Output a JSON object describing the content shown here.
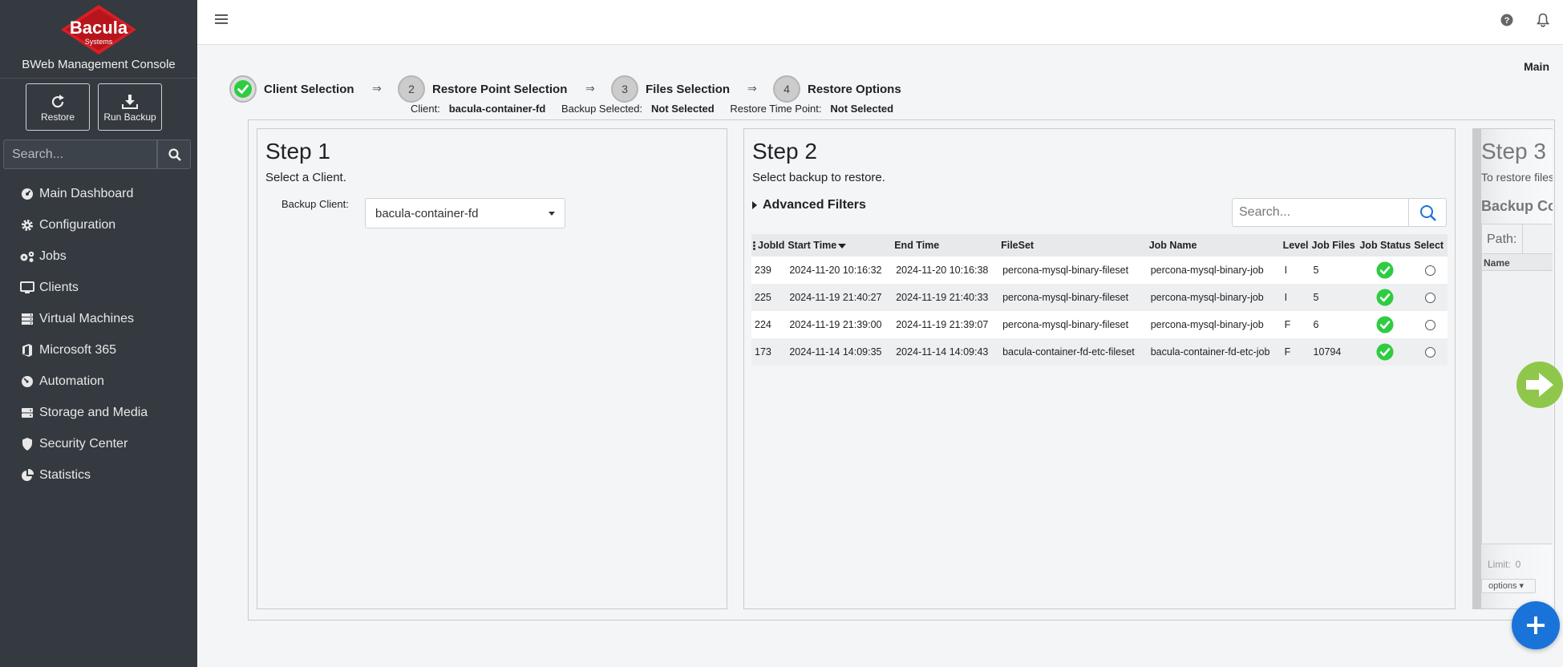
{
  "sidebar": {
    "logo_text": "Bacula",
    "logo_sub": "Systems",
    "console_title": "BWeb Management Console",
    "actions": [
      {
        "label": "Restore",
        "icon": "refresh-icon"
      },
      {
        "label": "Run Backup",
        "icon": "download-icon"
      }
    ],
    "search_placeholder": "Search...",
    "nav": [
      {
        "label": "Main Dashboard",
        "icon": "dashboard-icon"
      },
      {
        "label": "Configuration",
        "icon": "gear-icon"
      },
      {
        "label": "Jobs",
        "icon": "gears-icon"
      },
      {
        "label": "Clients",
        "icon": "monitor-icon"
      },
      {
        "label": "Virtual Machines",
        "icon": "server-icon"
      },
      {
        "label": "Microsoft 365",
        "icon": "office-icon"
      },
      {
        "label": "Automation",
        "icon": "gauge-icon"
      },
      {
        "label": "Storage and Media",
        "icon": "hdd-icon"
      },
      {
        "label": "Security Center",
        "icon": "shield-icon"
      },
      {
        "label": "Statistics",
        "icon": "pie-chart-icon"
      }
    ]
  },
  "topbar": {
    "main_link": "Main"
  },
  "wizard": {
    "steps": [
      {
        "number": "1",
        "label": "Client Selection",
        "done": true
      },
      {
        "number": "2",
        "label": "Restore Point Selection",
        "done": false
      },
      {
        "number": "3",
        "label": "Files Selection",
        "done": false
      },
      {
        "number": "4",
        "label": "Restore Options",
        "done": false
      }
    ],
    "arrow": "⇒",
    "summary": {
      "client_label": "Client:",
      "client_value": "bacula-container-fd",
      "backup_label": "Backup Selected:",
      "backup_value": "Not Selected",
      "time_label": "Restore Time Point:",
      "time_value": "Not Selected"
    }
  },
  "step1": {
    "title": "Step 1",
    "description": "Select a Client.",
    "client_label": "Backup Client:",
    "client_value": "bacula-container-fd"
  },
  "step2": {
    "title": "Step 2",
    "description": "Select backup to restore.",
    "advanced_filters": "Advanced Filters",
    "search_placeholder": "Search...",
    "columns": [
      "JobId",
      "Start Time",
      "End Time",
      "FileSet",
      "Job Name",
      "Level",
      "Job Files",
      "Job Status",
      "Select"
    ],
    "rows": [
      {
        "jobid": "239",
        "start": "2024-11-20 10:16:32",
        "end": "2024-11-20 10:16:38",
        "fileset": "percona-mysql-binary-fileset",
        "jobname": "percona-mysql-binary-job",
        "level": "I",
        "files": "5"
      },
      {
        "jobid": "225",
        "start": "2024-11-19 21:40:27",
        "end": "2024-11-19 21:40:33",
        "fileset": "percona-mysql-binary-fileset",
        "jobname": "percona-mysql-binary-job",
        "level": "I",
        "files": "5"
      },
      {
        "jobid": "224",
        "start": "2024-11-19 21:39:00",
        "end": "2024-11-19 21:39:07",
        "fileset": "percona-mysql-binary-fileset",
        "jobname": "percona-mysql-binary-job",
        "level": "F",
        "files": "6"
      },
      {
        "jobid": "173",
        "start": "2024-11-14 14:09:35",
        "end": "2024-11-14 14:09:43",
        "fileset": "bacula-container-fd-etc-fileset",
        "jobname": "bacula-container-fd-etc-job",
        "level": "F",
        "files": "10794"
      }
    ]
  },
  "step3": {
    "title": "Step 3",
    "description": "To restore files",
    "subtitle": "Backup Content",
    "path_label": "Path:",
    "name_col": "Name",
    "limit_label": "Limit:",
    "limit_value": "0",
    "options_label": "options"
  },
  "colors": {
    "sidebar_bg": "#343a40",
    "success_green": "#2ecc40",
    "next_green": "#8fc74a",
    "fab_blue": "#1a73d9"
  }
}
